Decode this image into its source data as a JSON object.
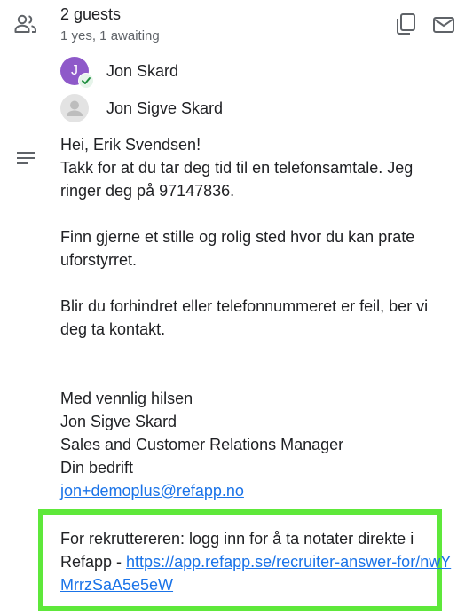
{
  "guests": {
    "title": "2 guests",
    "subtitle": "1 yes, 1 awaiting",
    "list": [
      {
        "initial": "J",
        "name": "Jon Skard",
        "status": "accepted"
      },
      {
        "initial": "",
        "name": "Jon Sigve Skard",
        "status": "awaiting"
      }
    ]
  },
  "description": {
    "greeting": "Hei, Erik Svendsen!",
    "line1": "Takk for at du tar deg tid til en telefonsamtale. Jeg ringer deg på 97147836.",
    "line2": "Finn gjerne et stille og rolig sted hvor du kan prate uforstyrret.",
    "line3": "Blir du forhindret eller telefonnummeret er feil, ber vi deg ta kontakt.",
    "sign_off": "Med vennlig hilsen",
    "sender_name": "Jon Sigve Skard",
    "sender_title": "Sales and Customer Relations Manager",
    "sender_company": "Din bedrift",
    "sender_email": "jon+demoplus@refapp.no",
    "recruiter_prefix": "For rekruttereren: logg inn for å ta notater direkte i Refapp - ",
    "recruiter_link": "https://app.refapp.se/recruiter-answer-for/nwYMrrzSaA5e5eW"
  },
  "colors": {
    "avatar_purple": "#8e59c9",
    "accepted_green": "#1e8e3e",
    "link_blue": "#1a73e8",
    "highlight_green": "#5ee83a"
  }
}
